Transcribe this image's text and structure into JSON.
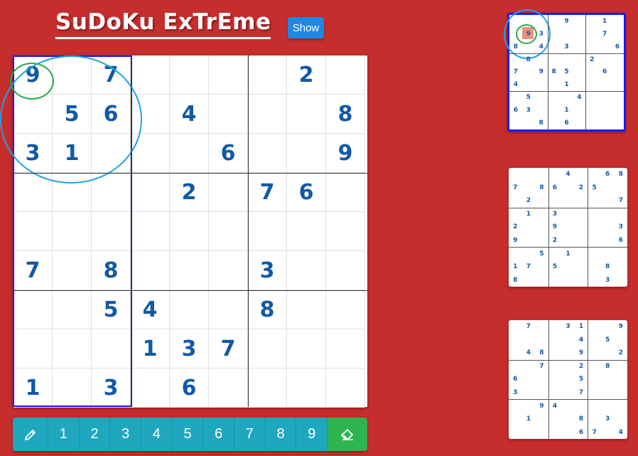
{
  "title": "SuDoKu ExTrEme",
  "show_button": "Show",
  "colors": {
    "background": "#c62d2d",
    "digit": "#1259a6",
    "highlight": "#1a1aff",
    "circle_outer": "#1ea3e6",
    "circle_inner": "#2aa84a",
    "numbar": "#1fa7bd",
    "eraser": "#2fb452",
    "mini_selected": "#e8947a"
  },
  "main_grid": [
    [
      "9",
      "",
      "7",
      "",
      "",
      "",
      "",
      "2",
      ""
    ],
    [
      "",
      "5",
      "6",
      "",
      "4",
      "",
      "",
      "",
      "8"
    ],
    [
      "3",
      "1",
      "",
      "",
      "",
      "6",
      "",
      "",
      "9"
    ],
    [
      "",
      "",
      "",
      "",
      "2",
      "",
      "7",
      "6",
      ""
    ],
    [
      "",
      "",
      "",
      "",
      "",
      "",
      "",
      "",
      ""
    ],
    [
      "7",
      "",
      "8",
      "",
      "",
      "",
      "3",
      "",
      ""
    ],
    [
      "",
      "",
      "5",
      "4",
      "",
      "",
      "8",
      "",
      ""
    ],
    [
      "",
      "",
      "",
      "1",
      "3",
      "7",
      "",
      "",
      ""
    ],
    [
      "1",
      "",
      "3",
      "",
      "6",
      "",
      "",
      "",
      ""
    ]
  ],
  "number_bar": {
    "pencil_icon": "pencil-icon",
    "numbers": [
      "1",
      "2",
      "3",
      "4",
      "5",
      "6",
      "7",
      "8",
      "9"
    ],
    "eraser_icon": "eraser-icon"
  },
  "mini_boards": [
    {
      "grid": [
        [
          "",
          "",
          "",
          "",
          "9",
          "",
          "",
          "1",
          ""
        ],
        [
          "",
          "9",
          "3",
          "",
          "",
          "",
          "",
          "7",
          ""
        ],
        [
          "8",
          "",
          "4",
          "",
          "3",
          "",
          "",
          "",
          "6"
        ],
        [
          "",
          "8",
          "",
          "",
          "",
          "",
          "2",
          "",
          ""
        ],
        [
          "7",
          "",
          "9",
          "8",
          "5",
          "",
          "",
          "6",
          ""
        ],
        [
          "4",
          "",
          "",
          "",
          "1",
          "",
          "",
          "",
          ""
        ],
        [
          "",
          "5",
          "",
          "",
          "",
          "4",
          "",
          "",
          ""
        ],
        [
          "6",
          "3",
          "",
          "",
          "1",
          "",
          "",
          "",
          ""
        ],
        [
          "",
          "",
          "8",
          "",
          "6",
          "",
          "",
          "",
          ""
        ]
      ]
    },
    {
      "grid": [
        [
          "",
          "",
          "",
          "",
          "4",
          "",
          "",
          "6",
          "8"
        ],
        [
          "7",
          "",
          "8",
          "6",
          "",
          "2",
          "5",
          "",
          ""
        ],
        [
          "",
          "2",
          "",
          "",
          "",
          "",
          "",
          "",
          "7"
        ],
        [
          "",
          "1",
          "",
          "3",
          "",
          "",
          "",
          "",
          ""
        ],
        [
          "2",
          "",
          "",
          "9",
          "",
          "",
          "",
          "",
          "3"
        ],
        [
          "9",
          "",
          "",
          "2",
          "",
          "",
          "",
          "",
          "6"
        ],
        [
          "",
          "",
          "5",
          "",
          "1",
          "",
          "",
          "",
          ""
        ],
        [
          "1",
          "7",
          "",
          "5",
          "",
          "",
          "",
          "8",
          ""
        ],
        [
          "8",
          "",
          "",
          "",
          "",
          "",
          "",
          "3",
          ""
        ]
      ]
    },
    {
      "grid": [
        [
          "",
          "7",
          "",
          "",
          "3",
          "1",
          "",
          "",
          "9"
        ],
        [
          "",
          "",
          "",
          "",
          "",
          "4",
          "",
          "5",
          ""
        ],
        [
          "",
          "4",
          "8",
          "",
          "",
          "9",
          "",
          "",
          "2"
        ],
        [
          "",
          "",
          "7",
          "",
          "",
          "2",
          "",
          "8",
          ""
        ],
        [
          "6",
          "",
          "",
          "",
          "",
          "5",
          "",
          "",
          ""
        ],
        [
          "3",
          "",
          "",
          "",
          "",
          "7",
          "",
          "",
          ""
        ],
        [
          "",
          "",
          "9",
          "4",
          "",
          "",
          "",
          "",
          ""
        ],
        [
          "",
          "1",
          "",
          "",
          "",
          "8",
          "",
          "3",
          ""
        ],
        [
          "",
          "",
          "",
          "",
          "",
          "6",
          "7",
          "",
          "4"
        ]
      ]
    }
  ]
}
